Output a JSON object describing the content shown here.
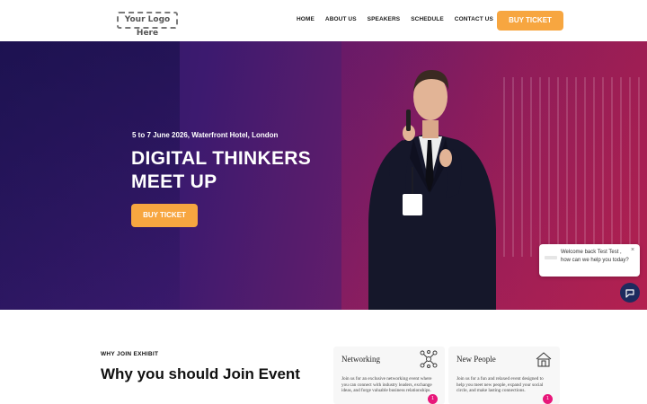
{
  "header": {
    "logo": "Your Logo Here",
    "nav": [
      "HOME",
      "ABOUT US",
      "SPEAKERS",
      "SCHEDULE",
      "CONTACT US"
    ],
    "cta": "BUY TICKET"
  },
  "hero": {
    "date_location": "5 to 7 June 2026, Waterfront Hotel, London",
    "title": "DIGITAL THINKERS MEET UP",
    "cta": "BUY TICKET"
  },
  "chat": {
    "message": "Welcome back Test Test , how can we help you today?",
    "close_icon": "close-icon",
    "launcher_icon": "chat-icon"
  },
  "why": {
    "eyebrow": "WHY JOIN EXHIBIT",
    "title": "Why you should Join Event",
    "cards": [
      {
        "title": "Networking",
        "icon": "network-icon",
        "text": "Join us for an exclusive networking event where you can connect with industry leaders, exchange ideas, and forge valuable business relationships.",
        "badge": "1"
      },
      {
        "title": "New People",
        "icon": "house-icon",
        "text": "Join us for a fun and relaxed event designed to help you meet new people, expand your social circle, and make lasting connections.",
        "badge": "1"
      }
    ]
  },
  "colors": {
    "accent": "#f7a640",
    "hero_start": "#2a1761",
    "hero_end": "#a8224f",
    "badge": "#e8177a",
    "launcher": "#1d2a5e"
  }
}
